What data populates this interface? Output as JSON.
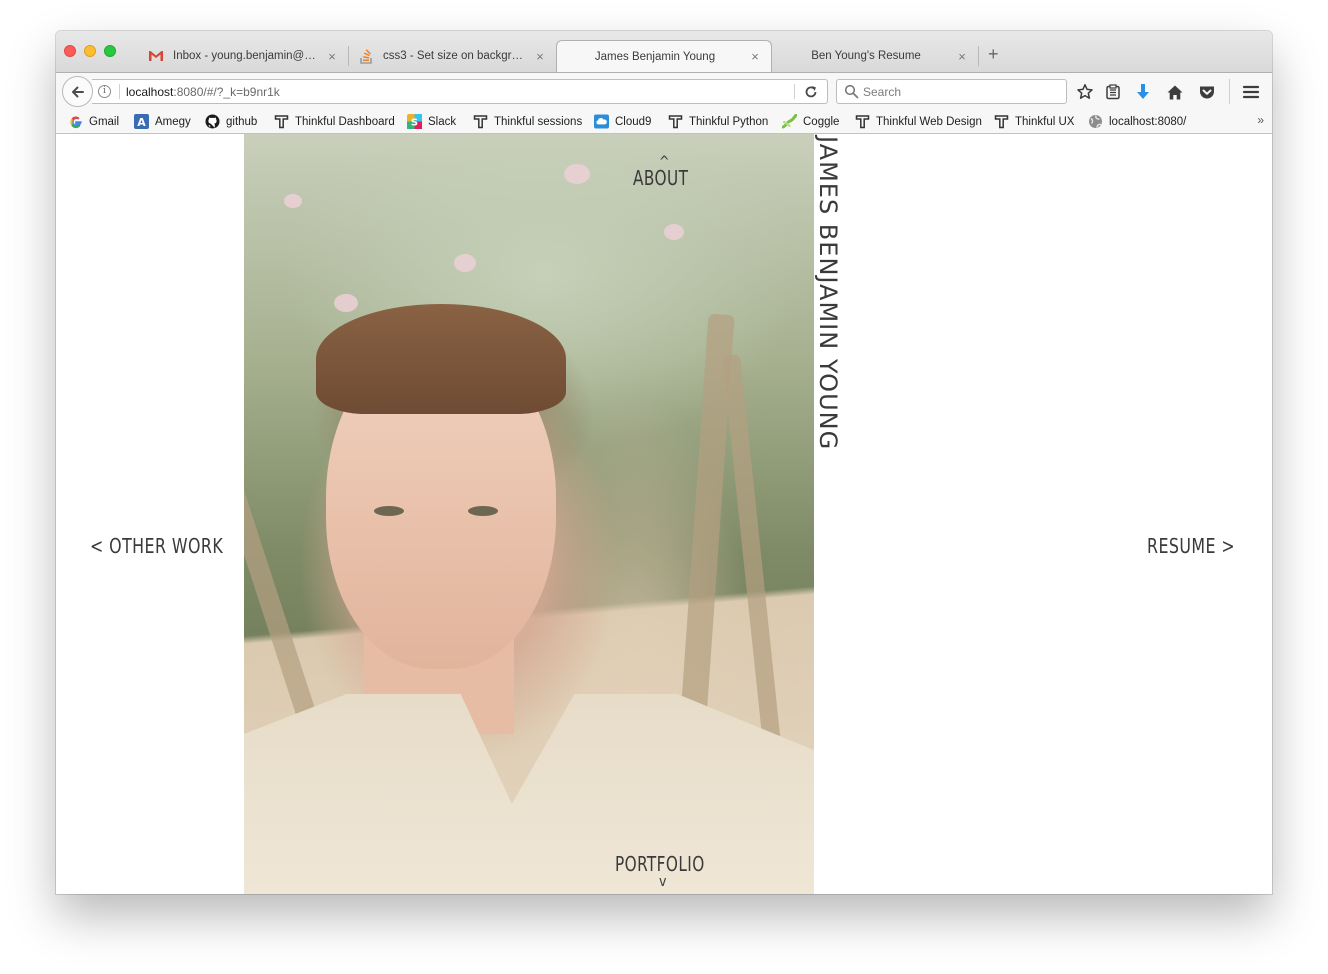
{
  "browser": {
    "tabs": [
      {
        "title": "Inbox - young.benjamin@g…",
        "icon": "gmail-icon",
        "active": false
      },
      {
        "title": "css3 - Set size on backgrou…",
        "icon": "stackoverflow-icon",
        "active": false
      },
      {
        "title": "James Benjamin Young",
        "icon": "",
        "active": true
      },
      {
        "title": "Ben Young's Resume",
        "icon": "",
        "active": false
      }
    ],
    "close_glyph": "×",
    "new_tab_glyph": "+",
    "address": {
      "host": "localhost",
      "rest": ":8080/#/?_k=b9nr1k"
    },
    "search_placeholder": "Search",
    "bookmarks": [
      {
        "label": "Gmail",
        "icon": "google-icon"
      },
      {
        "label": "Amegy",
        "icon": "amegy-icon"
      },
      {
        "label": "github",
        "icon": "github-icon"
      },
      {
        "label": "Thinkful Dashboard",
        "icon": "thinkful-icon"
      },
      {
        "label": "Slack",
        "icon": "slack-icon"
      },
      {
        "label": "Thinkful sessions",
        "icon": "thinkful-icon"
      },
      {
        "label": "Cloud9",
        "icon": "cloud9-icon"
      },
      {
        "label": "Thinkful Python",
        "icon": "thinkful-icon"
      },
      {
        "label": "Coggle",
        "icon": "coggle-icon"
      },
      {
        "label": "Thinkful Web Design",
        "icon": "thinkful-icon"
      },
      {
        "label": "Thinkful UX",
        "icon": "thinkful-icon"
      },
      {
        "label": "localhost:8080/",
        "icon": "globe-icon"
      }
    ],
    "overflow_glyph": "»"
  },
  "page": {
    "name": "JAMES BENJAMIN YOUNG",
    "nav": {
      "about": "ABOUT",
      "about_caret": "^",
      "portfolio": "PORTFOLIO",
      "portfolio_caret": "v",
      "other_work": "< OTHER WORK",
      "resume": "RESUME >"
    }
  },
  "colors": {
    "nav_text": "#3a3a3a",
    "chrome": "#f7f7f7",
    "download_arrow": "#2a90e6"
  }
}
